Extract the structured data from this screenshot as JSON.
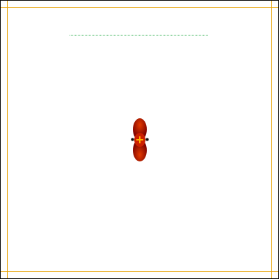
{
  "colors": {
    "frame": "#000000",
    "guide": "#e8a000",
    "dotted_ruler": "#22aa44",
    "blob_core": "#e23a00",
    "blob_edge": "#7a0000",
    "crosshair": "#ffb000"
  },
  "icons": {
    "crosshair": "plus-crosshair",
    "handle": "circle-handle"
  },
  "crosshair": {
    "glyph": "+"
  }
}
